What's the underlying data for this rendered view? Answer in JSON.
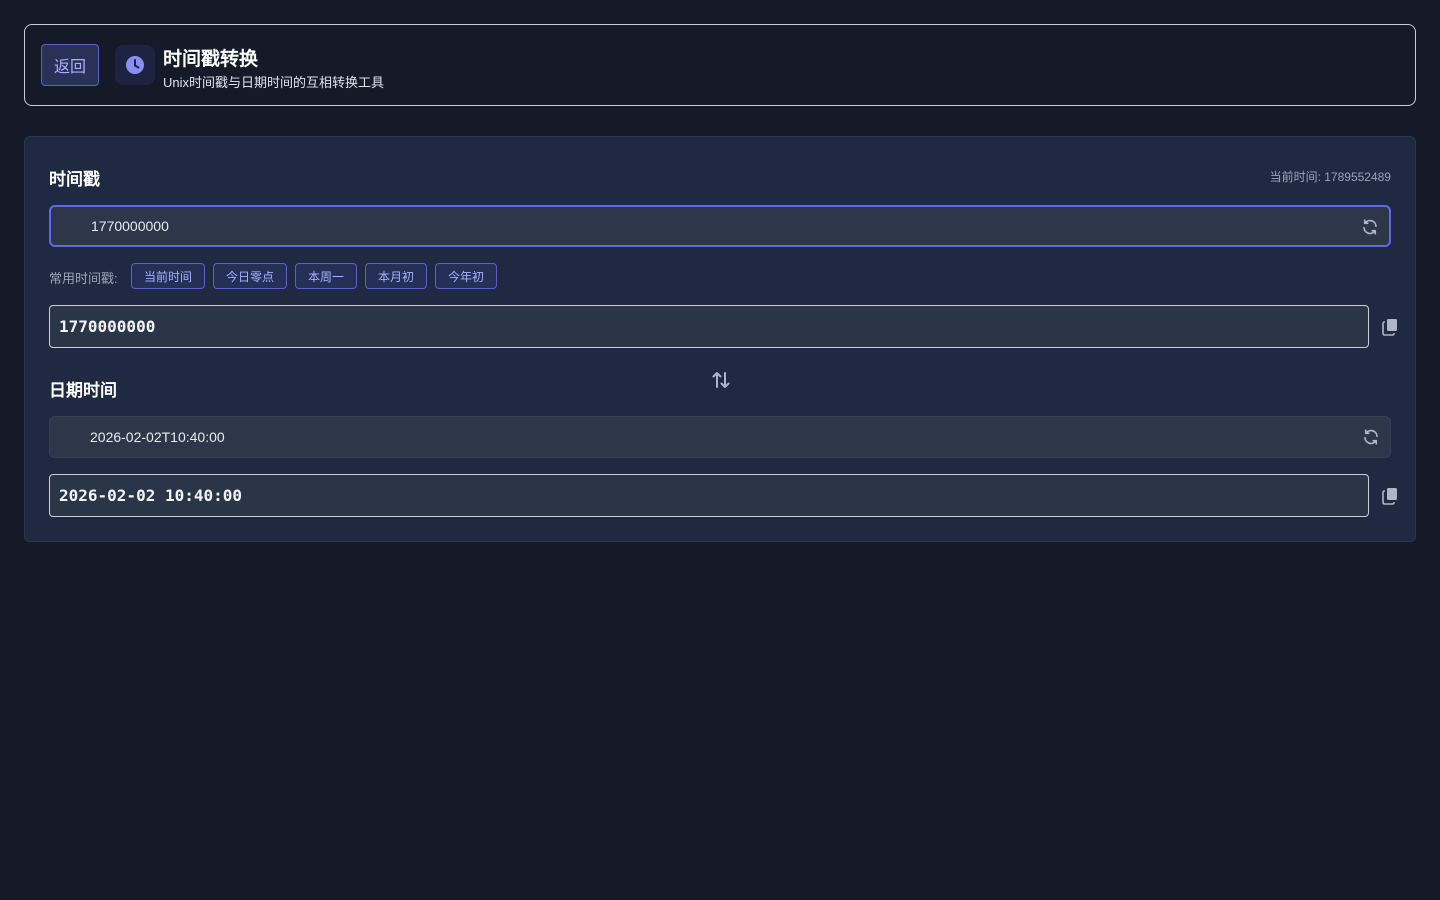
{
  "header": {
    "back_label": "返回",
    "logo_icon": "clock-icon",
    "title": "时间戳转换",
    "subtitle": "Unix时间戳与日期时间的互相转换工具"
  },
  "timestamp_section": {
    "title": "时间戳",
    "current_time_label": "当前时间: 1789552489",
    "input_value": "1770000000",
    "quick_label": "常用时间戳:",
    "quick_buttons": [
      "当前时间",
      "今日零点",
      "本周一",
      "本月初",
      "今年初"
    ],
    "output_value": "1770000000"
  },
  "datetime_section": {
    "title": "日期时间",
    "input_value": "2026-02-02T10:40:00",
    "output_value": "2026-02-02 10:40:00"
  },
  "colors": {
    "background": "#141a28",
    "card": "#1f2942",
    "accent": "#6366f1",
    "accent_text": "#a9b0ff"
  }
}
